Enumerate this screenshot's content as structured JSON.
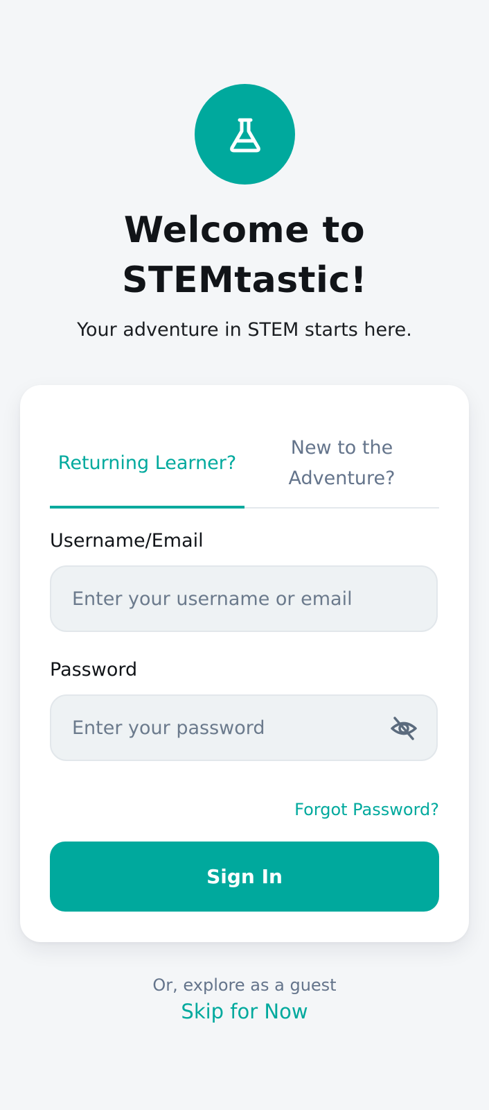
{
  "brand": {
    "accent_color": "#00a99d",
    "logo_icon": "flask-icon"
  },
  "header": {
    "title": "Welcome to STEMtastic!",
    "subtitle": "Your adventure in STEM starts here."
  },
  "auth": {
    "tabs": [
      {
        "label": "Returning Learner?",
        "active": true
      },
      {
        "label": "New to the Adventure?",
        "active": false
      }
    ],
    "username": {
      "label": "Username/Email",
      "placeholder": "Enter your username or email",
      "value": ""
    },
    "password": {
      "label": "Password",
      "placeholder": "Enter your password",
      "value": "",
      "toggle_icon": "eye-off-icon"
    },
    "forgot_label": "Forgot Password?",
    "submit_label": "Sign In"
  },
  "footer": {
    "guest_text": "Or, explore as a guest",
    "skip_label": "Skip for Now"
  }
}
